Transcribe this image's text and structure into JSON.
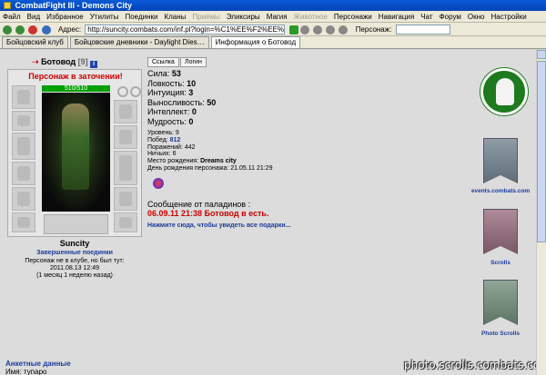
{
  "window": {
    "title": "CombatFight III - Demons City"
  },
  "menu": {
    "items": [
      {
        "label": "Файл",
        "enabled": true
      },
      {
        "label": "Вид",
        "enabled": true
      },
      {
        "label": "Избранное",
        "enabled": true
      },
      {
        "label": "Утилиты",
        "enabled": true
      },
      {
        "label": "Поединки",
        "enabled": true
      },
      {
        "label": "Кланы",
        "enabled": true
      },
      {
        "label": "Приёмы",
        "enabled": false
      },
      {
        "label": "Эликсиры",
        "enabled": true
      },
      {
        "label": "Магия",
        "enabled": true
      },
      {
        "label": "Животное",
        "enabled": false
      },
      {
        "label": "Персонажи",
        "enabled": true
      },
      {
        "label": "Навигация",
        "enabled": true
      },
      {
        "label": "Чат",
        "enabled": true
      },
      {
        "label": "Форум",
        "enabled": true
      },
      {
        "label": "Окно",
        "enabled": true
      },
      {
        "label": "Настройки",
        "enabled": true
      }
    ]
  },
  "address": {
    "label": "Адрес:",
    "url": "http://suncity.combats.com/inf.pl?login=%C1%EE%F2%EE%E2%EE%E4",
    "person_label": "Персонаж:"
  },
  "tabs": [
    {
      "label": "Бойцовский клуб",
      "active": false
    },
    {
      "label": "Бойцовские дневники - Daylight Dies…",
      "active": false
    },
    {
      "label": "Информация о Ботовод",
      "active": true
    }
  ],
  "character": {
    "name": "Ботовод",
    "level": "[9]",
    "status": "Персонаж в заточении!",
    "hp": "510/510",
    "city": "Suncity",
    "battles_link": "Завершенные поединки",
    "not_in_club": "Персонаж не в клубе, но был тут:",
    "last_seen": "2011.08.13 12:49",
    "last_seen_ago": "(1 месяц 1 неделю назад)"
  },
  "buttons": {
    "link": "Ссылка",
    "logins": "Логин"
  },
  "stats": [
    {
      "label": "Сила:",
      "value": "53"
    },
    {
      "label": "Ловкость:",
      "value": "10"
    },
    {
      "label": "Интуиция:",
      "value": "3"
    },
    {
      "label": "Выносливость:",
      "value": "50"
    },
    {
      "label": "Интеллект:",
      "value": "0"
    },
    {
      "label": "Мудрость:",
      "value": "0"
    }
  ],
  "info": [
    {
      "label": "Уровень:",
      "value": "9",
      "style": "plain"
    },
    {
      "label": "Побед:",
      "value": "812",
      "style": "blue"
    },
    {
      "label": "Поражений:",
      "value": "442",
      "style": "plain"
    },
    {
      "label": "Ничьих:",
      "value": "6",
      "style": "plain"
    },
    {
      "label": "Место рождения:",
      "value": "Dreams city",
      "style": "bold"
    },
    {
      "label": "День рождения персонажа:",
      "value": "21.05.11 21:29",
      "style": "plain"
    }
  ],
  "paladins": {
    "title": "Сообщение от паладинов :",
    "message": "06.09.11 21:38 Ботовод в есть."
  },
  "gifts_link": "Нажмите сюда, чтобы увидеть все подарки...",
  "sidebar": {
    "events_label": "events.combats.com",
    "scrolls_label": "Scrolls",
    "photo_label": "Photo Scrolls"
  },
  "bottom": {
    "section_title": "Анкетные данные",
    "name_label": "Имя: тупаро"
  },
  "watermark": "photo.scrolls.combats.com",
  "colors": {
    "accent_blue": "#1a3c9c",
    "alert_red": "#d00000",
    "hp_green": "#00a000",
    "logo_green": "#1e7a1e"
  }
}
